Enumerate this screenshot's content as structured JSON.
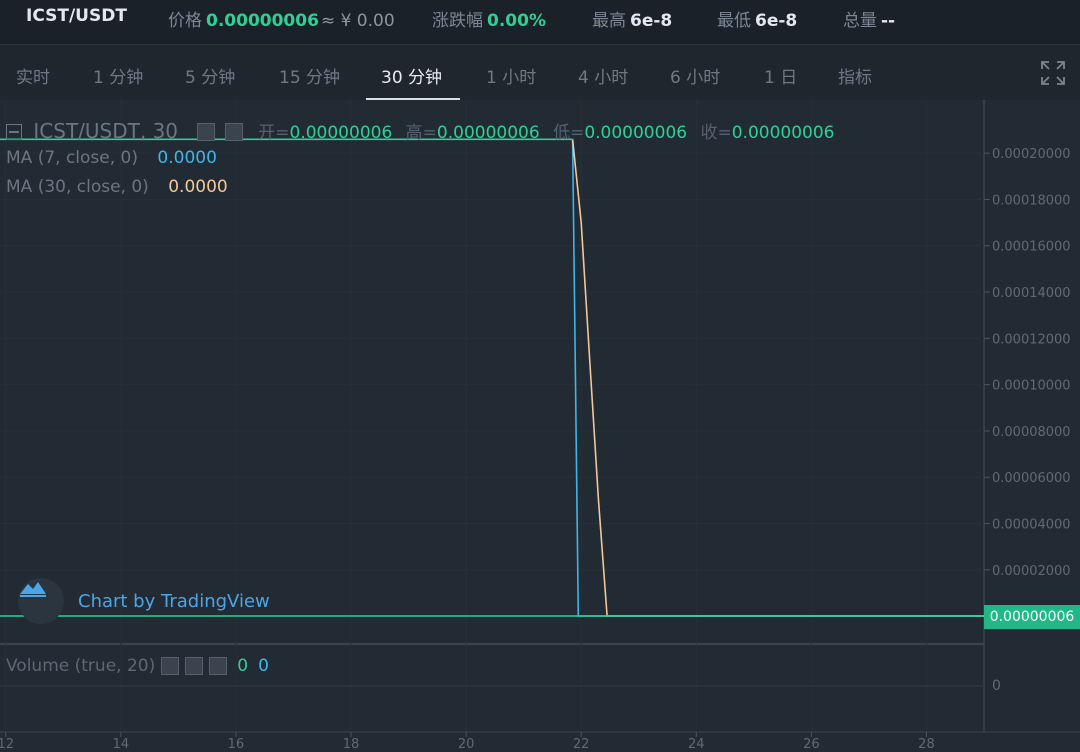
{
  "ticker": {
    "symbol": "ICST/USDT",
    "price_label": "价格",
    "price_value": "0.00000006",
    "price_cny": "≈ ¥ 0.00",
    "change_label": "涨跌幅",
    "change_value": "0.00%",
    "high_label": "最高",
    "high_value": "6e-8",
    "low_label": "最低",
    "low_value": "6e-8",
    "volume_label": "总量",
    "volume_value": "--"
  },
  "tabs": [
    {
      "label": "实时"
    },
    {
      "label": "1 分钟"
    },
    {
      "label": "5 分钟"
    },
    {
      "label": "15 分钟"
    },
    {
      "label": "30 分钟",
      "active": true
    },
    {
      "label": "1 小时"
    },
    {
      "label": "4 小时"
    },
    {
      "label": "6 小时"
    },
    {
      "label": "1 日"
    },
    {
      "label": "指标"
    }
  ],
  "legend": {
    "title": "ICST/USDT, 30",
    "open_label": "开=",
    "open_value": "0.00000006",
    "high_label": "高=",
    "high_value": "0.00000006",
    "low_label": "低=",
    "low_value": "0.00000006",
    "close_label": "收=",
    "close_value": "0.00000006",
    "ma7_label": "MA (7, close, 0)",
    "ma7_value": "0.0000",
    "ma30_label": "MA (30, close, 0)",
    "ma30_value": "0.0000"
  },
  "watermark": "Chart by TradingView",
  "price_badge": "0.00000006",
  "volume": {
    "label": "Volume (true, 20)",
    "value_a": "0",
    "value_b": "0",
    "axis_zero": "0"
  },
  "colors": {
    "accent_green": "#2fcf96",
    "ma7": "#3fb5e8",
    "ma30": "#f0c89a",
    "badge": "#1fb886"
  },
  "icons": {
    "fullscreen": "expand-icon",
    "collapse": "collapse-square-icon",
    "watermark": "tradingview-logo-icon"
  },
  "chart_data": {
    "type": "line",
    "title": "ICST/USDT, 30",
    "xlabel": "",
    "ylabel": "",
    "x_ticks": [
      "12",
      "14",
      "16",
      "18",
      "20",
      "22",
      "24",
      "26",
      "28"
    ],
    "x_tick_values": [
      12,
      14,
      16,
      18,
      20,
      22,
      24,
      26,
      28
    ],
    "y_ticks": [
      "0.00002000",
      "0.00004000",
      "0.00006000",
      "0.00008000",
      "0.00010000",
      "0.00012000",
      "0.00014000",
      "0.00016000",
      "0.00018000",
      "0.00020000"
    ],
    "y_tick_values": [
      2e-05,
      4e-05,
      6e-05,
      8e-05,
      0.0001,
      0.00012,
      0.00014,
      0.00016,
      0.00018,
      0.0002
    ],
    "xlim": [
      11.9,
      29.0
    ],
    "ylim": [
      6e-08,
      0.00021
    ],
    "grid": true,
    "series": [
      {
        "name": "MA (7, close, 0)",
        "color": "#3fb5e8",
        "points": [
          [
            21.85,
            0.000206
          ],
          [
            21.95,
            6e-08
          ],
          [
            29.0,
            6e-08
          ]
        ]
      },
      {
        "name": "MA (30, close, 0)",
        "color": "#f0c89a",
        "points": [
          [
            21.85,
            0.000206
          ],
          [
            22.0,
            0.00017
          ],
          [
            22.15,
            0.00011
          ],
          [
            22.3,
            5e-05
          ],
          [
            22.45,
            6e-08
          ],
          [
            29.0,
            6e-08
          ]
        ]
      },
      {
        "name": "",
        "color": "#2fcf96",
        "points": [
          [
            11.9,
            6e-08
          ],
          [
            29.0,
            6e-08
          ]
        ]
      },
      {
        "name": "",
        "color": "#2fcf96",
        "points": [
          [
            11.9,
            0.000206
          ],
          [
            21.85,
            0.000206
          ]
        ]
      }
    ]
  }
}
